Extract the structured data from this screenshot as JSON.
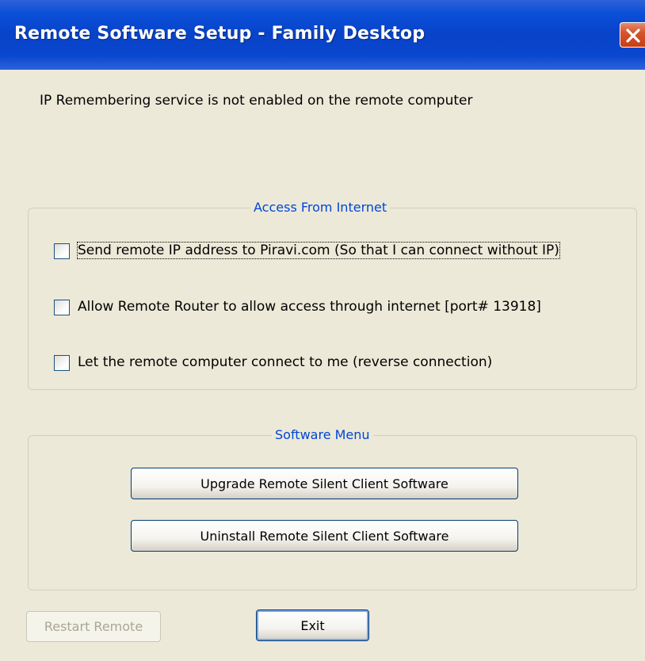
{
  "window": {
    "title": "Remote Software Setup - Family Desktop",
    "close_icon": "close-icon"
  },
  "message": "IP Remembering service is not enabled on the remote computer",
  "access_group": {
    "title": "Access From Internet",
    "options": [
      {
        "label": "Send remote IP address to Piravi.com  (So that I can connect without IP)",
        "checked": false
      },
      {
        "label": "Allow Remote Router to allow access through internet [port# 13918]",
        "checked": false
      },
      {
        "label": "Let the remote computer connect to me (reverse connection)",
        "checked": false
      }
    ]
  },
  "software_group": {
    "title": "Software Menu",
    "upgrade_label": "Upgrade Remote Silent Client Software",
    "uninstall_label": "Uninstall Remote Silent Client Software"
  },
  "footer": {
    "restart_label": "Restart Remote",
    "restart_enabled": false,
    "exit_label": "Exit"
  },
  "colors": {
    "titlebar": "#0a4ed8",
    "dialog_bg": "#ece9d8",
    "group_title": "#0046d5",
    "close_button": "#c73e16"
  }
}
